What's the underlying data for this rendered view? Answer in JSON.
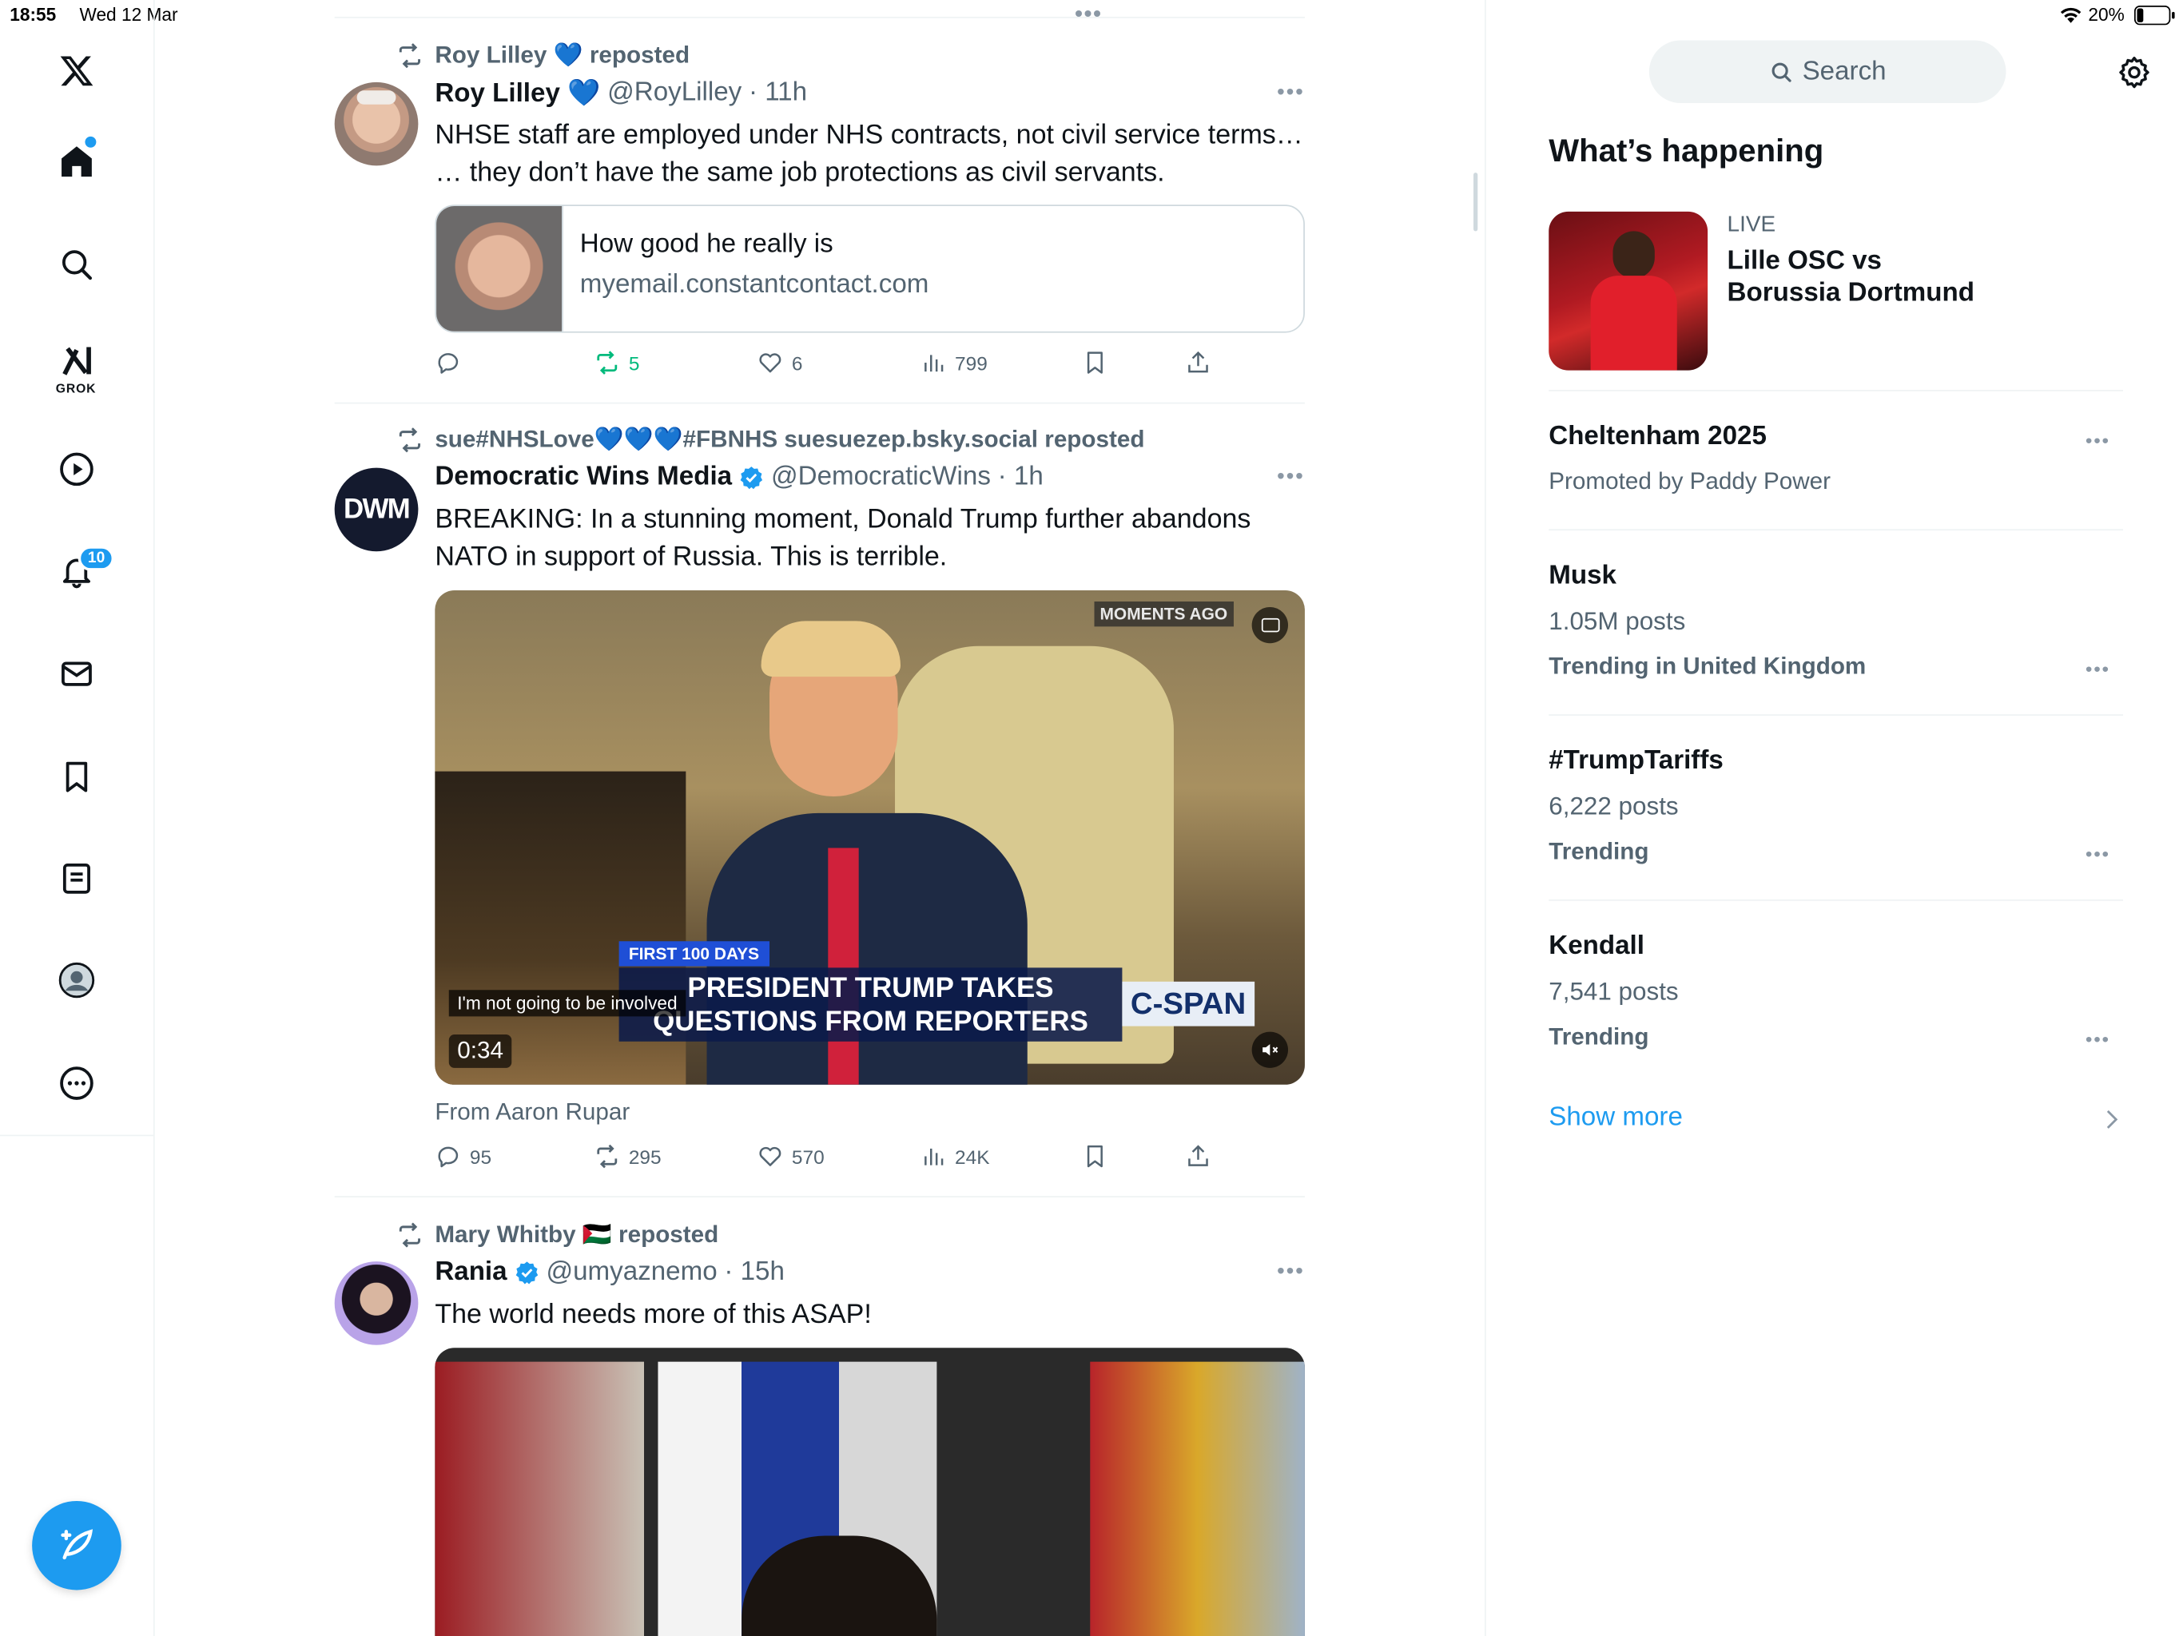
{
  "status_bar": {
    "time": "18:55",
    "date": "Wed 12 Mar",
    "battery": "20%"
  },
  "nav": {
    "grok_label": "GROK",
    "notifications_count": "10"
  },
  "feed": {
    "posts": [
      {
        "repost_by": "Roy Lilley 💙 reposted",
        "name": "Roy Lilley 💙",
        "handle": "@RoyLilley",
        "time": "· 11h",
        "text1": "NHSE staff are employed under NHS contracts, not civil service terms…",
        "text2": "… they don’t have the same job protections as civil servants.",
        "card_title": "How good he really is",
        "card_domain": "myemail.constantcontact.com",
        "replies": "",
        "reposts": "5",
        "likes": "6",
        "views": "799"
      },
      {
        "repost_by": "sue#NHSLove💙💙💙#FBNHS suesuezep.bsky.social reposted",
        "name": "Democratic Wins Media",
        "handle": "@DemocraticWins",
        "time": "· 1h",
        "text1": "BREAKING: In a stunning moment, Donald Trump further abandons",
        "text2": "NATO in support of Russia. This is terrible.",
        "avatar_text": "DWM",
        "video_badge": "MOMENTS AGO",
        "video_tag": "FIRST 100 DAYS",
        "video_headline1": "PRESIDENT TRUMP TAKES",
        "video_headline2": "QUESTIONS FROM REPORTERS",
        "video_logo": "C-SPAN",
        "video_caption": "I'm not going to be involved",
        "video_duration": "0:34",
        "from_line": "From Aaron Rupar",
        "replies": "95",
        "reposts": "295",
        "likes": "570",
        "views": "24K"
      },
      {
        "repost_by": "Mary Whitby 🇵🇸 reposted",
        "name": "Rania",
        "handle": "@umyaznemo",
        "time": "· 15h",
        "text1": "The world needs more of this ASAP!"
      }
    ]
  },
  "right": {
    "search_placeholder": "Search",
    "section_title": "What’s happening",
    "live": {
      "label": "LIVE",
      "title1": "Lille OSC vs",
      "title2": "Borussia Dortmund"
    },
    "trends": [
      {
        "title": "Cheltenham 2025",
        "sub": "Promoted by Paddy Power",
        "ctx": ""
      },
      {
        "title": "Musk",
        "sub": "1.05M posts",
        "ctx": "Trending in United Kingdom"
      },
      {
        "title": "#TrumpTariffs",
        "sub": "6,222 posts",
        "ctx": "Trending"
      },
      {
        "title": "Kendall",
        "sub": "7,541 posts",
        "ctx": "Trending"
      }
    ],
    "show_more": "Show more"
  },
  "colors": {
    "accent": "#1d9bf0",
    "repost_green": "#00ba7c",
    "muted": "#536471"
  }
}
